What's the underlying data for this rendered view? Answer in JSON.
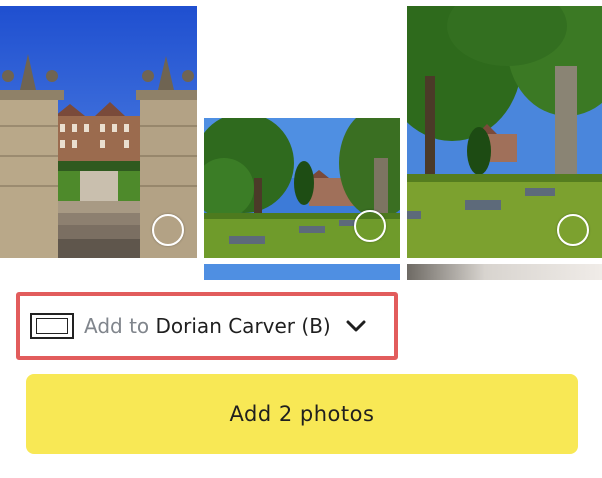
{
  "photos": [
    {
      "label": "photo-castle-gate",
      "selected": false
    },
    {
      "label": "photo-lawn-trees",
      "selected": false
    },
    {
      "label": "photo-tall-trees",
      "selected": false
    }
  ],
  "album_selector": {
    "prefix": "Add to ",
    "album_name": "Dorian Carver (B)",
    "icon": "album-frame-icon",
    "dropdown_icon": "chevron-down-icon"
  },
  "primary_action": {
    "label": "Add 2 photos"
  },
  "colors": {
    "highlight_border": "#e25c5c",
    "button_bg": "#f8e855",
    "prefix_text": "#80858c"
  }
}
